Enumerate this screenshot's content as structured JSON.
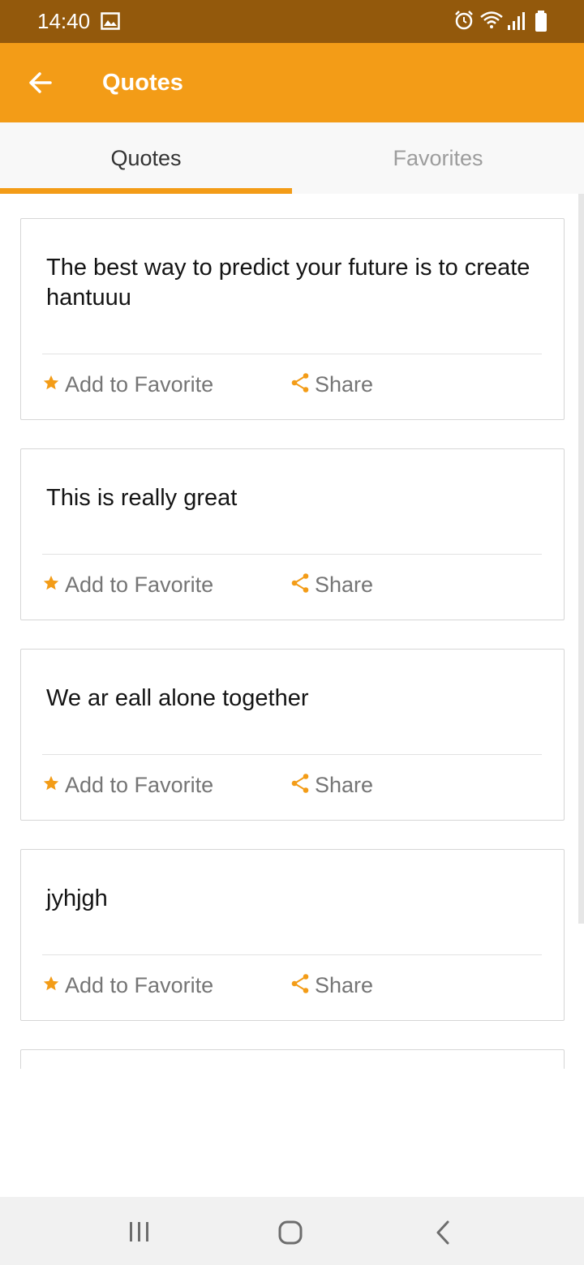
{
  "status_bar": {
    "time": "14:40",
    "icons": [
      "image-icon",
      "alarm-icon",
      "wifi-icon",
      "signal-icon",
      "battery-icon"
    ]
  },
  "app_bar": {
    "title": "Quotes",
    "back_icon": "arrow-back-icon"
  },
  "tabs": [
    {
      "label": "Quotes",
      "selected": true
    },
    {
      "label": "Favorites",
      "selected": false
    }
  ],
  "quotes": [
    {
      "text": "The best way to predict your future is to create hantuuu",
      "favorite_label": "Add to Favorite",
      "share_label": "Share"
    },
    {
      "text": "This is really great",
      "favorite_label": "Add to Favorite",
      "share_label": "Share"
    },
    {
      "text": "We ar eall alone together",
      "favorite_label": "Add to Favorite",
      "share_label": "Share"
    },
    {
      "text": "jyhjgh",
      "favorite_label": "Add to Favorite",
      "share_label": "Share"
    }
  ],
  "colors": {
    "accent": "#f39c17",
    "status_bar": "#93590c"
  },
  "nav_bar": {
    "icons": [
      "recent-apps-icon",
      "home-icon",
      "back-icon"
    ]
  }
}
